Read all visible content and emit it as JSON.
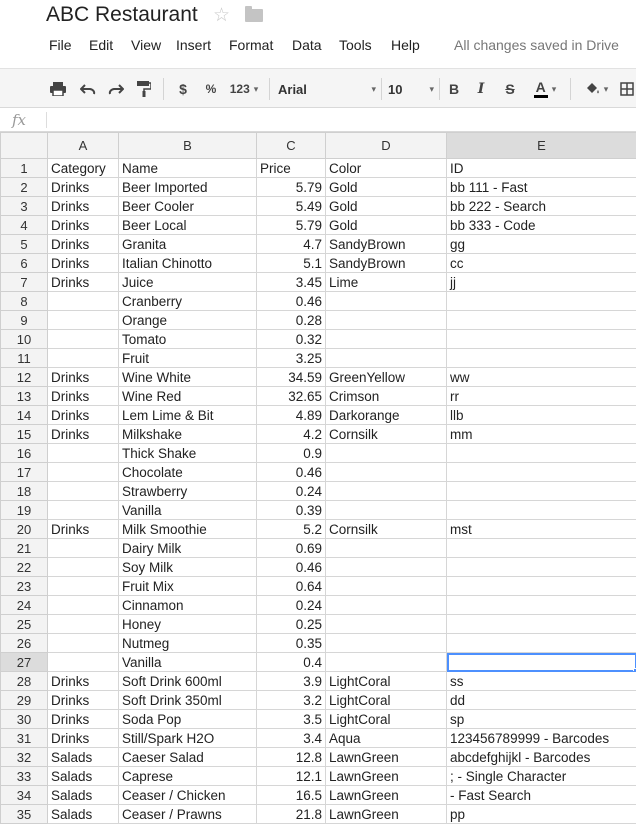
{
  "doc": {
    "title": "ABC Restaurant",
    "save_status": "All changes saved in Drive"
  },
  "menu": [
    "File",
    "Edit",
    "View",
    "Insert",
    "Format",
    "Data",
    "Tools",
    "Help"
  ],
  "toolbar": {
    "print_icon": "print-icon",
    "undo_icon": "undo-icon",
    "redo_icon": "redo-icon",
    "paint_format_icon": "paint-format-icon",
    "currency_label": "$",
    "percent_label": "%",
    "number_format_label": "123",
    "font_name": "Arial",
    "font_size": "10",
    "bold_label": "B",
    "italic_label": "I",
    "strike_label": "S",
    "text_color_label": "A",
    "fill_icon": "fill-color-icon",
    "borders_icon": "borders-icon"
  },
  "formula_bar": {
    "fx_label": "fx",
    "value": ""
  },
  "active_cell": {
    "row": 27,
    "col": "E"
  },
  "columns": [
    "A",
    "B",
    "C",
    "D",
    "E"
  ],
  "rows": [
    {
      "n": "1",
      "a": "Category",
      "b": "Name",
      "c": "Price",
      "d": "Color",
      "e": "ID",
      "c_is_num": false
    },
    {
      "n": "2",
      "a": "Drinks",
      "b": "Beer Imported",
      "c": "5.79",
      "d": "Gold",
      "e": "bb 111 - Fast"
    },
    {
      "n": "3",
      "a": "Drinks",
      "b": "Beer Cooler",
      "c": "5.49",
      "d": "Gold",
      "e": "bb 222 - Search"
    },
    {
      "n": "4",
      "a": "Drinks",
      "b": "Beer Local",
      "c": "5.79",
      "d": "Gold",
      "e": "bb 333 - Code"
    },
    {
      "n": "5",
      "a": "Drinks",
      "b": "Granita",
      "c": "4.7",
      "d": "SandyBrown",
      "e": "gg"
    },
    {
      "n": "6",
      "a": "Drinks",
      "b": "Italian Chinotto",
      "c": "5.1",
      "d": "SandyBrown",
      "e": "cc"
    },
    {
      "n": "7",
      "a": "Drinks",
      "b": "Juice",
      "c": "3.45",
      "d": "Lime",
      "e": "jj"
    },
    {
      "n": "8",
      "a": "",
      "b": "Cranberry",
      "c": "0.46",
      "d": "",
      "e": ""
    },
    {
      "n": "9",
      "a": "",
      "b": "Orange",
      "c": "0.28",
      "d": "",
      "e": ""
    },
    {
      "n": "10",
      "a": "",
      "b": "Tomato",
      "c": "0.32",
      "d": "",
      "e": ""
    },
    {
      "n": "11",
      "a": "",
      "b": "Fruit",
      "c": "3.25",
      "d": "",
      "e": ""
    },
    {
      "n": "12",
      "a": "Drinks",
      "b": "Wine White",
      "c": "34.59",
      "d": "GreenYellow",
      "e": "ww"
    },
    {
      "n": "13",
      "a": "Drinks",
      "b": "Wine Red",
      "c": "32.65",
      "d": "Crimson",
      "e": "rr"
    },
    {
      "n": "14",
      "a": "Drinks",
      "b": "Lem Lime & Bit",
      "c": "4.89",
      "d": "Darkorange",
      "e": "llb"
    },
    {
      "n": "15",
      "a": "Drinks",
      "b": "Milkshake",
      "c": "4.2",
      "d": "Cornsilk",
      "e": "mm"
    },
    {
      "n": "16",
      "a": "",
      "b": "Thick Shake",
      "c": "0.9",
      "d": "",
      "e": ""
    },
    {
      "n": "17",
      "a": "",
      "b": "Chocolate",
      "c": "0.46",
      "d": "",
      "e": ""
    },
    {
      "n": "18",
      "a": "",
      "b": "Strawberry",
      "c": "0.24",
      "d": "",
      "e": ""
    },
    {
      "n": "19",
      "a": "",
      "b": "Vanilla",
      "c": "0.39",
      "d": "",
      "e": ""
    },
    {
      "n": "20",
      "a": "Drinks",
      "b": "Milk Smoothie",
      "c": "5.2",
      "d": "Cornsilk",
      "e": "mst"
    },
    {
      "n": "21",
      "a": "",
      "b": "Dairy Milk",
      "c": "0.69",
      "d": "",
      "e": ""
    },
    {
      "n": "22",
      "a": "",
      "b": "Soy Milk",
      "c": "0.46",
      "d": "",
      "e": ""
    },
    {
      "n": "23",
      "a": "",
      "b": "Fruit Mix",
      "c": "0.64",
      "d": "",
      "e": ""
    },
    {
      "n": "24",
      "a": "",
      "b": "Cinnamon",
      "c": "0.24",
      "d": "",
      "e": ""
    },
    {
      "n": "25",
      "a": "",
      "b": "Honey",
      "c": "0.25",
      "d": "",
      "e": ""
    },
    {
      "n": "26",
      "a": "",
      "b": "Nutmeg",
      "c": "0.35",
      "d": "",
      "e": ""
    },
    {
      "n": "27",
      "a": "",
      "b": "Vanilla",
      "c": "0.4",
      "d": "",
      "e": ""
    },
    {
      "n": "28",
      "a": "Drinks",
      "b": "Soft Drink 600ml",
      "c": "3.9",
      "d": "LightCoral",
      "e": "ss"
    },
    {
      "n": "29",
      "a": "Drinks",
      "b": "Soft Drink 350ml",
      "c": "3.2",
      "d": "LightCoral",
      "e": "dd"
    },
    {
      "n": "30",
      "a": "Drinks",
      "b": "Soda Pop",
      "c": "3.5",
      "d": "LightCoral",
      "e": "sp"
    },
    {
      "n": "31",
      "a": "Drinks",
      "b": "Still/Spark H2O",
      "c": "3.4",
      "d": "Aqua",
      "e": "123456789999 - Barcodes"
    },
    {
      "n": "32",
      "a": "Salads",
      "b": "Caeser Salad",
      "c": "12.8",
      "d": "LawnGreen",
      "e": "abcdefghijkl - Barcodes"
    },
    {
      "n": "33",
      "a": "Salads",
      "b": "Caprese",
      "c": "12.1",
      "d": "LawnGreen",
      "e": "; - Single Character"
    },
    {
      "n": "34",
      "a": "Salads",
      "b": "Ceaser / Chicken",
      "c": "16.5",
      "d": "LawnGreen",
      "e": "- Fast Search"
    },
    {
      "n": "35",
      "a": "Salads",
      "b": "Ceaser / Prawns",
      "c": "21.8",
      "d": "LawnGreen",
      "e": "pp"
    }
  ]
}
